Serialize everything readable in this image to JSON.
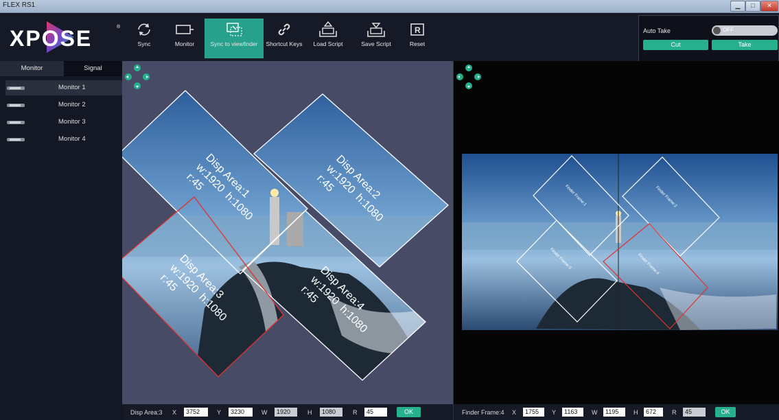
{
  "window": {
    "title": "FLEX RS1"
  },
  "toolbar": {
    "logo_text": "XPOSE",
    "items": [
      {
        "label": "Sync",
        "icon": "sync-icon"
      },
      {
        "label": "Monitor",
        "icon": "monitor-icon"
      },
      {
        "label": "Sync to viewfinder",
        "icon": "sync-viewfinder-icon",
        "active": true
      },
      {
        "label": "Shortcut Keys",
        "icon": "link-icon"
      },
      {
        "label": "Load Script",
        "icon": "load-icon"
      },
      {
        "label": "Save Script",
        "icon": "save-icon"
      },
      {
        "label": "Reset",
        "icon": "reset-icon"
      }
    ]
  },
  "take_panel": {
    "auto_take_label": "Auto Take",
    "toggle_state": "OFF",
    "cut_label": "Cut",
    "take_label": "Take"
  },
  "left_panel": {
    "tabs": [
      {
        "label": "Monitor",
        "active": true
      },
      {
        "label": "Signal",
        "active": false
      }
    ],
    "monitors": [
      {
        "label": "Monitor 1",
        "selected": true
      },
      {
        "label": "Monitor 2",
        "selected": false
      },
      {
        "label": "Monitor 3",
        "selected": false
      },
      {
        "label": "Monitor 4",
        "selected": false
      }
    ]
  },
  "disp_areas": [
    {
      "name": "Disp Area:1",
      "w": "w:1920",
      "h": "h:1080",
      "r": "r:45",
      "selected": false
    },
    {
      "name": "Disp Area:2",
      "w": "w:1920",
      "h": "h:1080",
      "r": "r:45",
      "selected": false
    },
    {
      "name": "Disp Area:3",
      "w": "w:1920",
      "h": "h:1080",
      "r": "r:45",
      "selected": true
    },
    {
      "name": "Disp Area:4",
      "w": "w:1920",
      "h": "h:1080",
      "r": "r:45",
      "selected": false
    }
  ],
  "finder_frames": [
    {
      "name": "Finder Frame:1"
    },
    {
      "name": "Finder Frame:2"
    },
    {
      "name": "Finder Frame:3"
    },
    {
      "name": "Finder Frame:4",
      "selected": true
    }
  ],
  "disp_status": {
    "label": "Disp Area:3",
    "x_label": "X",
    "x": "3752",
    "y_label": "Y",
    "y": "3230",
    "w_label": "W",
    "w": "1920",
    "h_label": "H",
    "h": "1080",
    "r_label": "R",
    "r": "45",
    "ok_label": "OK"
  },
  "finder_status": {
    "label": "Finder Frame:4",
    "x_label": "X",
    "x": "1755",
    "y_label": "Y",
    "y": "1163",
    "w_label": "W",
    "w": "1195",
    "h_label": "H",
    "h": "672",
    "r_label": "R",
    "r": "45",
    "ok_label": "OK"
  },
  "colors": {
    "accent": "#27b08e",
    "selected_outline": "#e0322e",
    "canvas_bg": "#474b66"
  }
}
